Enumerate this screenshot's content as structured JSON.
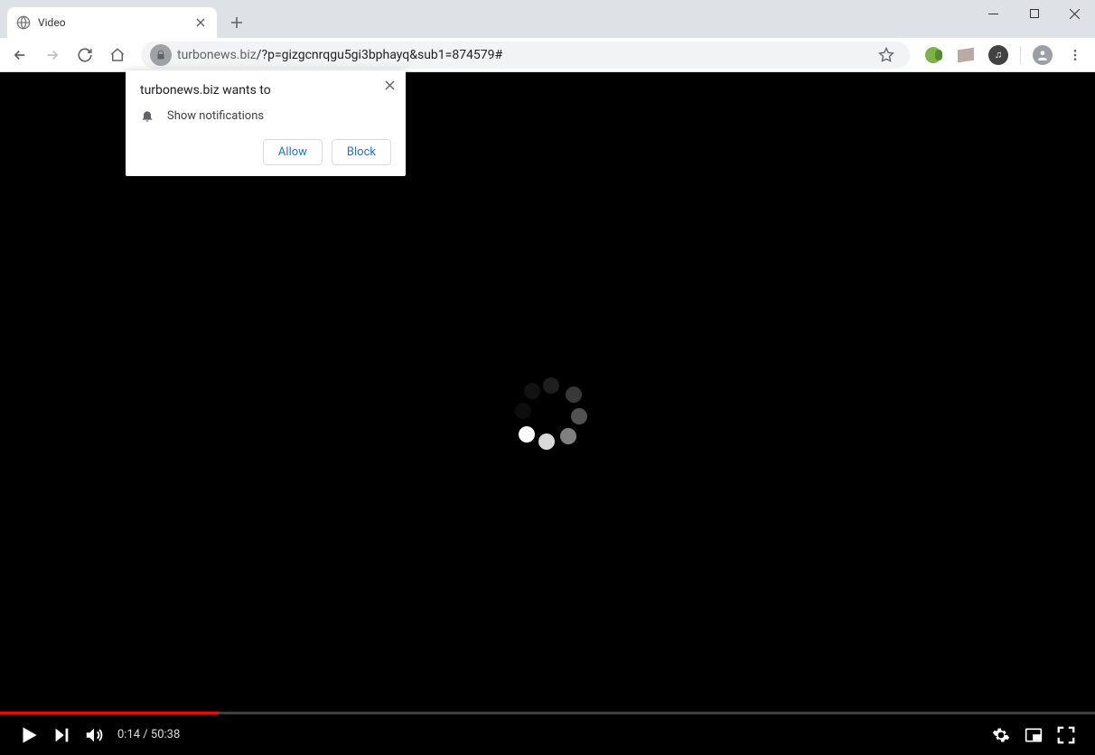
{
  "tab": {
    "title": "Video"
  },
  "omnibox": {
    "host": "turbonews.biz",
    "path": "/?p=gizgcnrqgu5gi3bphayq&sub1=874579#"
  },
  "prompt": {
    "title": "turbonews.biz wants to",
    "permission": "Show notifications",
    "allow": "Allow",
    "block": "Block"
  },
  "video": {
    "current": "0:14",
    "sep": " / ",
    "total": "50:38",
    "progress_pct": 20
  }
}
